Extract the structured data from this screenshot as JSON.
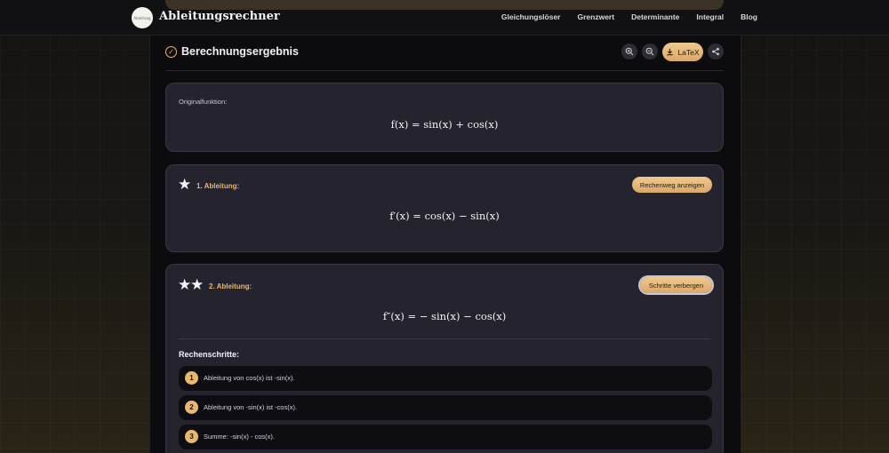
{
  "header": {
    "brand": "Ableitungsrechner",
    "logo_text": "Ableitung",
    "nav": [
      "Gleichungslöser",
      "Grenzwert",
      "Determinante",
      "Integral",
      "Blog"
    ]
  },
  "result": {
    "title": "Berechnungsergebnis",
    "latex_label": "LaTeX",
    "tools": [
      "zoom-in-icon",
      "zoom-out-icon",
      "download-icon",
      "share-icon"
    ]
  },
  "original": {
    "label": "Originalfunktion:",
    "formula": "f(x) = sin(x) + cos(x)"
  },
  "first": {
    "label": "1. Ableitung:",
    "button": "Rechenweg anzeigen",
    "formula": "f′(x) = cos(x) − sin(x)"
  },
  "second": {
    "label": "2. Ableitung:",
    "button": "Schritte verbergen",
    "formula": "f″(x) = − sin(x) − cos(x)",
    "steps_title": "Rechenschritte:",
    "steps": [
      {
        "num": "1",
        "text": "Ableitung von cos(x) ist -sin(x)."
      },
      {
        "num": "2",
        "text": "Ableitung von -sin(x) ist -cos(x)."
      },
      {
        "num": "3",
        "text": "Summe: -sin(x) - cos(x)."
      }
    ]
  },
  "colors": {
    "accent": "#e8b871",
    "card_bg": "#24232e",
    "page_bg": "#0c0c0f"
  }
}
